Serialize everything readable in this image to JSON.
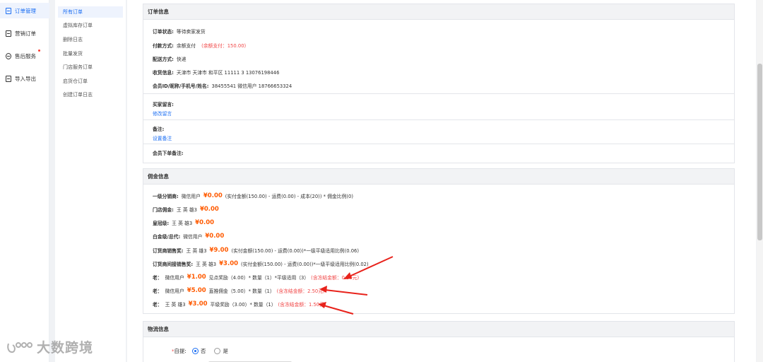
{
  "sidebar": {
    "items": [
      {
        "label": "订单管理",
        "icon": "order-icon",
        "active": true
      },
      {
        "label": "营销订单",
        "icon": "marketing-icon"
      },
      {
        "label": "售后服务",
        "icon": "service-icon"
      },
      {
        "label": "导入导出",
        "icon": "import-export-icon"
      }
    ]
  },
  "subnav": {
    "items": [
      "所有订单",
      "虚拟库存订单",
      "删除日志",
      "批量发货",
      "门店服务订单",
      "启货仓订单",
      "创建订单日志"
    ]
  },
  "order_info": {
    "title": "订单信息",
    "status_label": "订单状态:",
    "status_value": "等待卖家发货",
    "pay_label": "付款方式:",
    "pay_value": "余额支付",
    "pay_note": "(余额支付：150.00)",
    "ship_label": "配送方式:",
    "ship_value": "快递",
    "recv_label": "收货信息:",
    "recv_value": "天津市 天津市 和平区 11111  3  13076198446",
    "member_label": "会员ID/昵称/手机号/姓名:",
    "member_value": "38455541  微信用户  18766653324",
    "buyer_msg_label": "买家留言:",
    "buyer_msg_link": "修改留言",
    "remark_label": "备注:",
    "remark_link": "设置备注",
    "member_remark_label": "会员下单备注:"
  },
  "commission": {
    "title": "佣金信息",
    "rows": [
      {
        "label": "一级分销商:",
        "name": "微信用户",
        "amount": "¥0.00",
        "desc": "(实付金额(150.00) - 运费(0.00) - 成本(20)) * 佣金比例(0)",
        "note": ""
      },
      {
        "label": "门店佣金:",
        "name": "王 英 雄3",
        "amount": "¥0.00",
        "desc": "",
        "note": ""
      },
      {
        "label": "皇冠级:",
        "name": "王 英 雄3",
        "amount": "¥0.00",
        "desc": "",
        "note": ""
      },
      {
        "label": "白金级/总代:",
        "name": "微信用户",
        "amount": "¥0.00",
        "desc": "",
        "note": ""
      },
      {
        "label": "订货商销售奖:",
        "name": "王 英 雄3",
        "amount": "¥9.00",
        "desc": "(实付金额(150.00) - 运费(0.00))*一级平级适用比例(0.06)",
        "note": ""
      },
      {
        "label": "订货商间接销售奖:",
        "name": "王 英 雄3",
        "amount": "¥3.00",
        "desc": "(实付金额(150.00) - 运费(0.00))*一级平级适用比例(0.02)",
        "note": ""
      },
      {
        "label": "老：",
        "name": "微信用户",
        "amount": "¥1.00",
        "desc": "见点奖励（4.00）* 数量（1）*平级适用（3）",
        "note": "(含冻结金额：0.50元)"
      },
      {
        "label": "老：",
        "name": "微信用户",
        "amount": "¥5.00",
        "desc": "直推佣金（5.00）* 数量（1）",
        "note": "(含冻结金额：2.50元)"
      },
      {
        "label": "老：",
        "name": "王 英 雄3",
        "amount": "¥3.00",
        "desc": "平级奖励（3.00）* 数量（1）",
        "note": "(含冻结金额：1.50元)"
      }
    ]
  },
  "logistics": {
    "title": "物流信息",
    "self_pickup_label": "自提:",
    "opt_no": "否",
    "opt_yes": "是"
  },
  "watermark": {
    "text": "大数跨境"
  }
}
